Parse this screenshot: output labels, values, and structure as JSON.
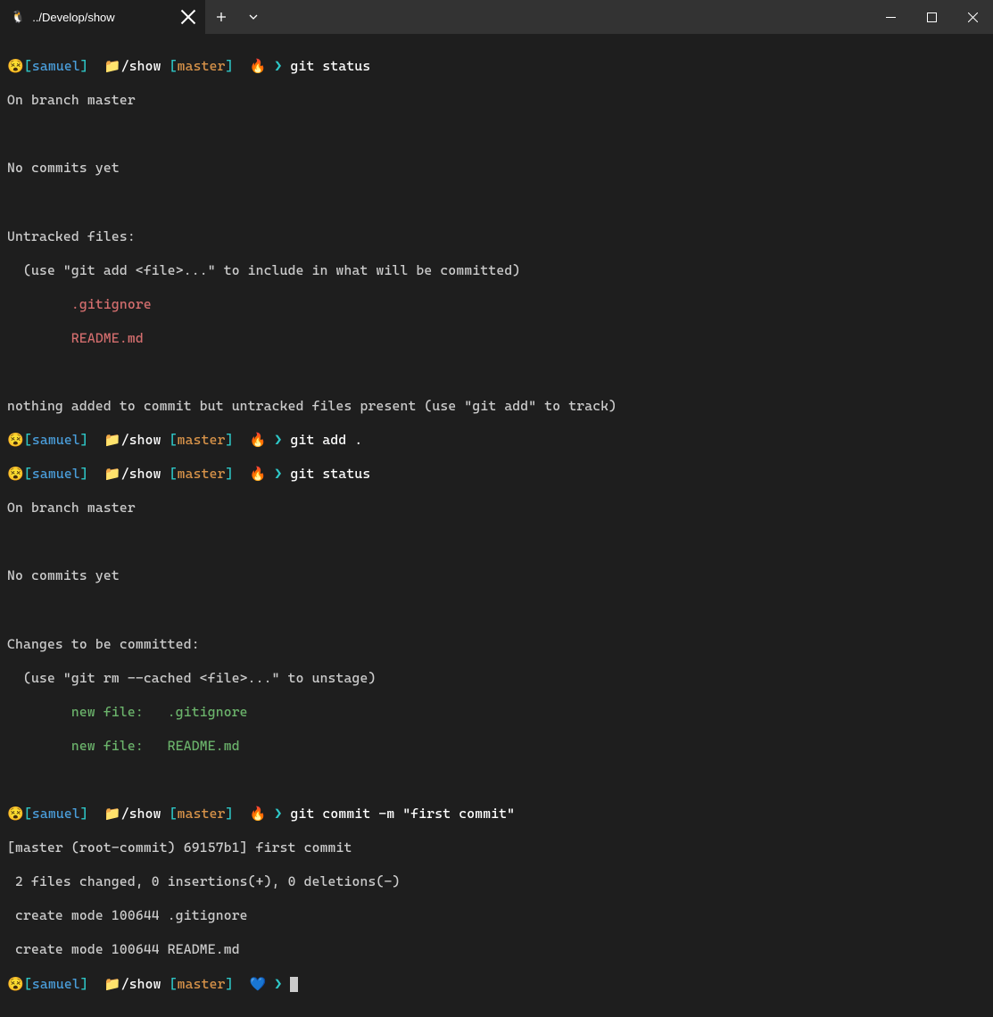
{
  "tab": {
    "title": "../Develop/show",
    "icon": "🐧"
  },
  "prompts": [
    {
      "face": "😵",
      "user_open": "[",
      "user": "samuel",
      "user_close": "]",
      "folder_icon": "📁",
      "path": "/show",
      "branch_open": "[",
      "branch": "master",
      "branch_close": "]",
      "status_emoji": "🔥",
      "arrow": "❯",
      "command": "git status"
    },
    {
      "face": "😵",
      "user_open": "[",
      "user": "samuel",
      "user_close": "]",
      "folder_icon": "📁",
      "path": "/show",
      "branch_open": "[",
      "branch": "master",
      "branch_close": "]",
      "status_emoji": "🔥",
      "arrow": "❯",
      "command": "git add ."
    },
    {
      "face": "😵",
      "user_open": "[",
      "user": "samuel",
      "user_close": "]",
      "folder_icon": "📁",
      "path": "/show",
      "branch_open": "[",
      "branch": "master",
      "branch_close": "]",
      "status_emoji": "🔥",
      "arrow": "❯",
      "command": "git status"
    },
    {
      "face": "😵",
      "user_open": "[",
      "user": "samuel",
      "user_close": "]",
      "folder_icon": "📁",
      "path": "/show",
      "branch_open": "[",
      "branch": "master",
      "branch_close": "]",
      "status_emoji": "🔥",
      "arrow": "❯",
      "command": "git commit -m \"first commit\""
    },
    {
      "face": "😵",
      "user_open": "[",
      "user": "samuel",
      "user_close": "]",
      "folder_icon": "📁",
      "path": "/show",
      "branch_open": "[",
      "branch": "master",
      "branch_close": "]",
      "status_emoji": "💙",
      "arrow": "❯",
      "command": ""
    }
  ],
  "output": {
    "status1": {
      "l1": "On branch master",
      "l2": "No commits yet",
      "l3": "Untracked files:",
      "l4": "  (use \"git add <file>...\" to include in what will be committed)",
      "f1": "        .gitignore",
      "f2": "        README.md",
      "l5": "nothing added to commit but untracked files present (use \"git add\" to track)"
    },
    "status2": {
      "l1": "On branch master",
      "l2": "No commits yet",
      "l3": "Changes to be committed:",
      "l4": "  (use \"git rm --cached <file>...\" to unstage)",
      "f1": "        new file:   .gitignore",
      "f2": "        new file:   README.md"
    },
    "commit": {
      "l1": "[master (root-commit) 69157b1] first commit",
      "l2": " 2 files changed, 0 insertions(+), 0 deletions(-)",
      "l3": " create mode 100644 .gitignore",
      "l4": " create mode 100644 README.md"
    }
  }
}
